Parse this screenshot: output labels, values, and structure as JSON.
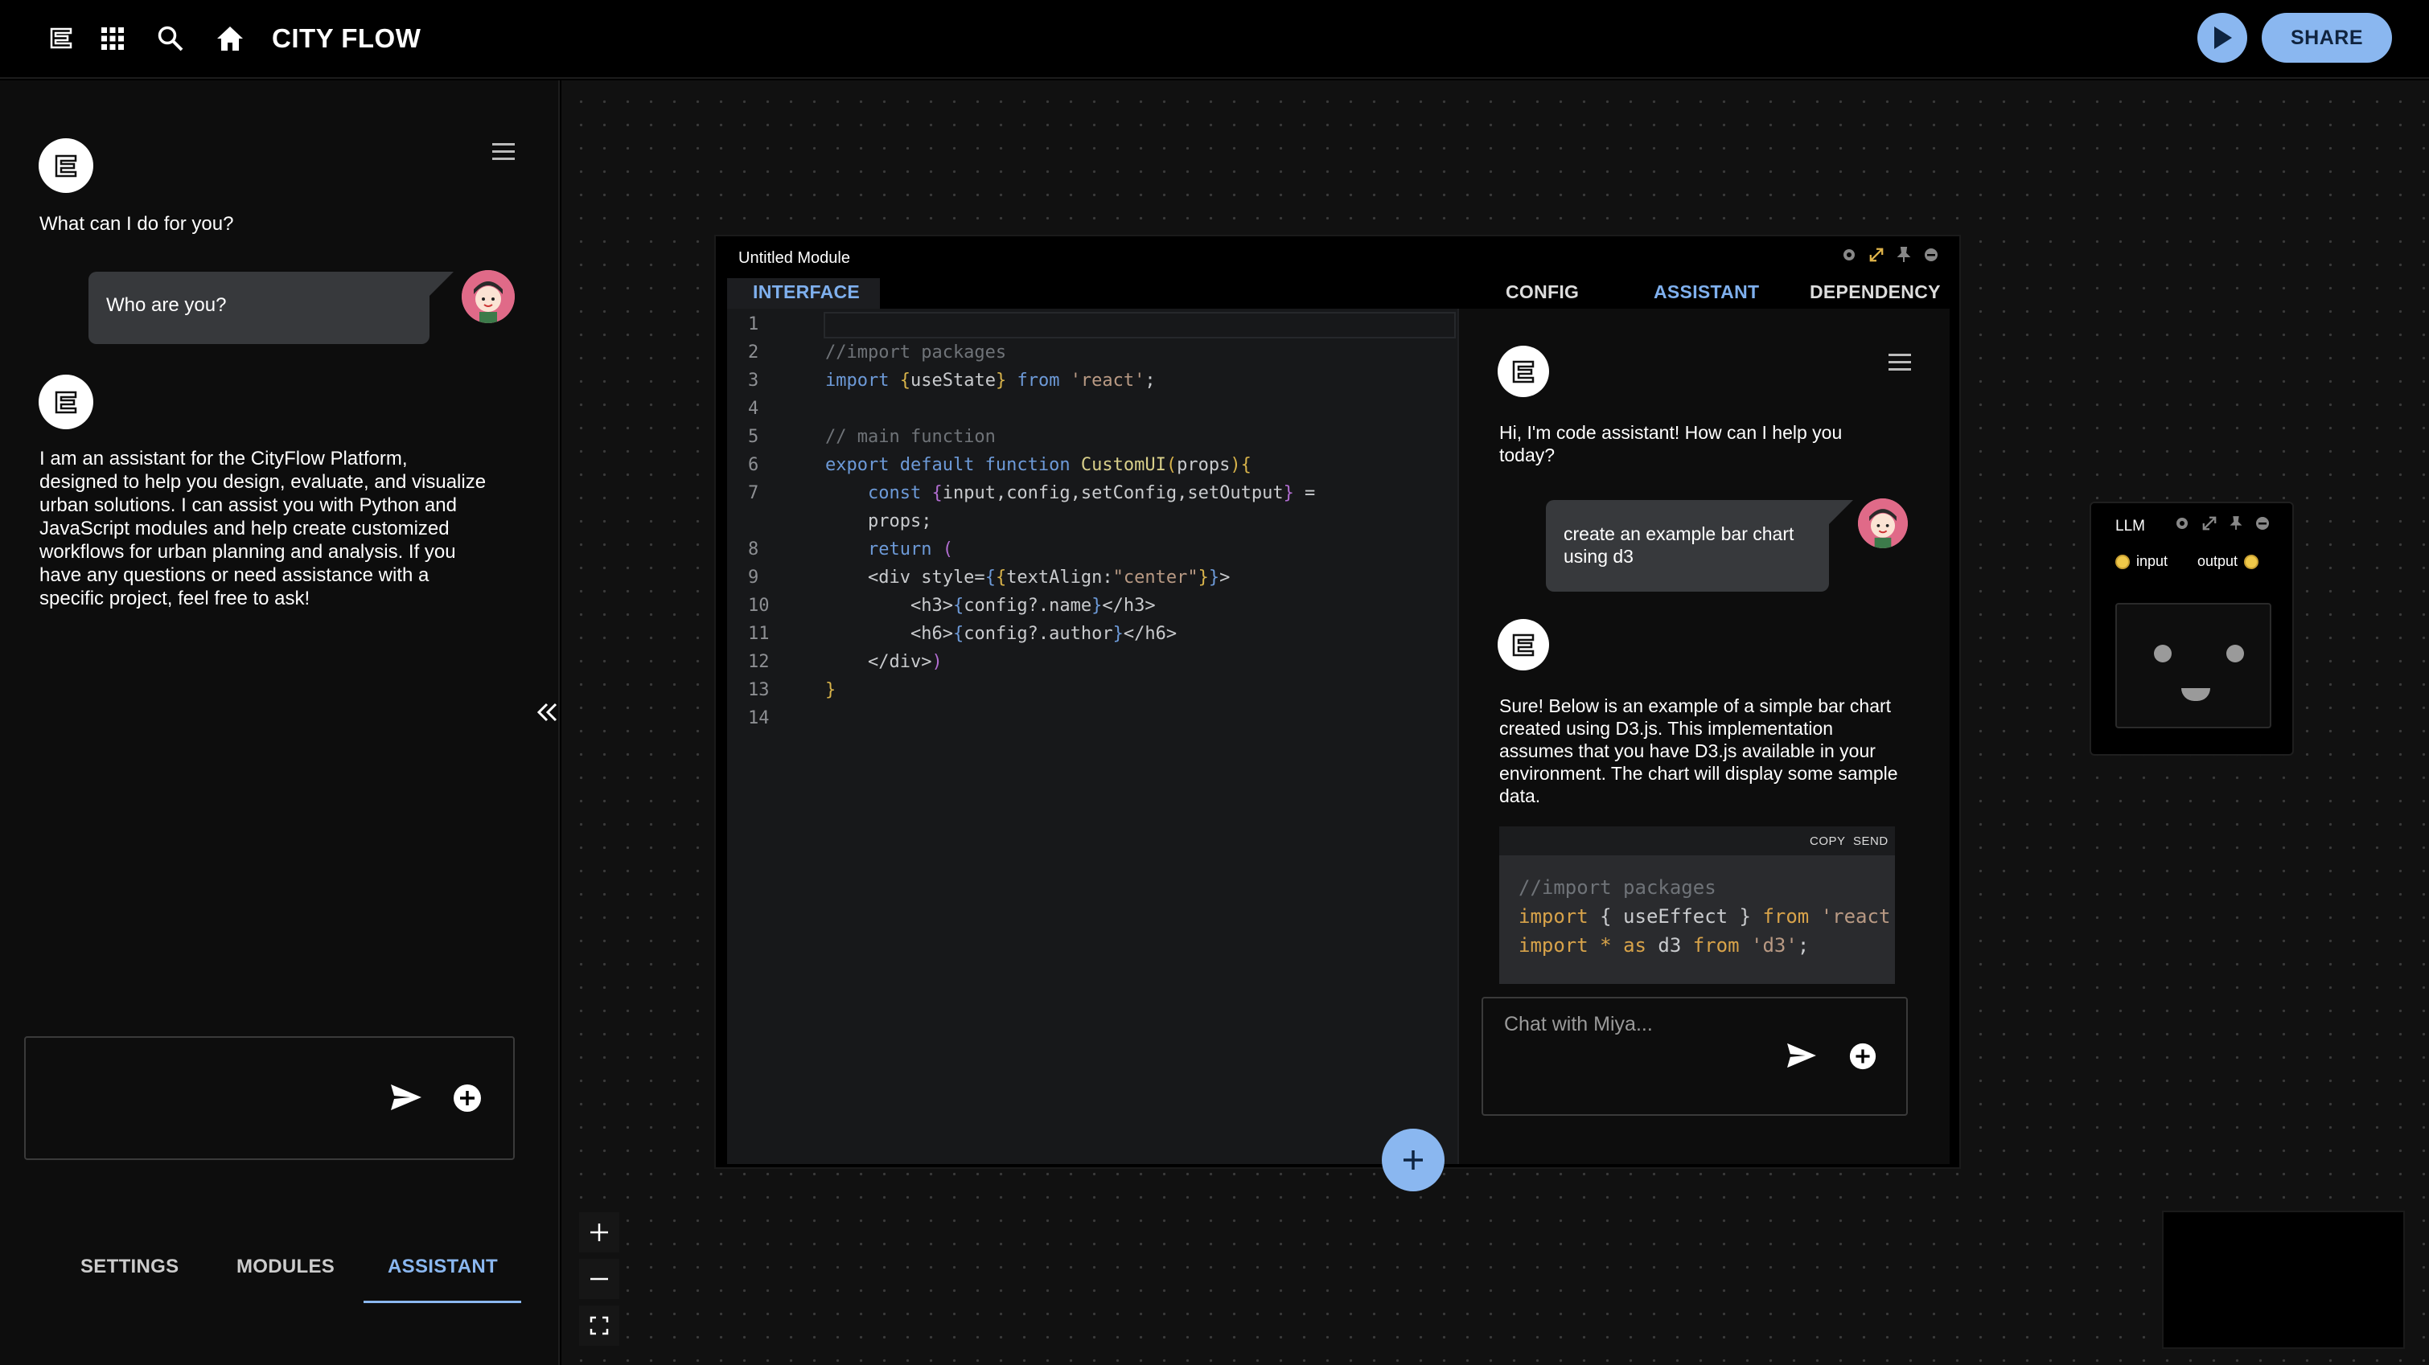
{
  "app": {
    "title": "CITY FLOW",
    "share_label": "SHARE"
  },
  "left_panel": {
    "greeting": "What can I do for you?",
    "user_message": "Who are you?",
    "assistant_reply": "I am an assistant for the CityFlow Platform, designed to help you design, evaluate, and visualize urban solutions. I can assist you with Python and JavaScript modules and help create customized workflows for urban planning and analysis. If you have any questions or need assistance with a specific project, feel free to ask!",
    "input_value": "",
    "tabs": [
      {
        "label": "SETTINGS"
      },
      {
        "label": "MODULES"
      },
      {
        "label": "ASSISTANT"
      }
    ]
  },
  "module": {
    "title": "Untitled Module",
    "tabs": [
      {
        "label": "INTERFACE"
      },
      {
        "label": "CONFIG"
      },
      {
        "label": "ASSISTANT"
      },
      {
        "label": "DEPENDENCY"
      }
    ],
    "line_numbers": [
      "1",
      "2",
      "3",
      "4",
      "5",
      "6",
      "7",
      "",
      "8",
      "9",
      "10",
      "11",
      "12",
      "13",
      "14"
    ],
    "assistant": {
      "greeting": "Hi, I'm code assistant! How can I help you today?",
      "user_message": "create an example bar chart using d3",
      "reply": "Sure! Below is an example of a simple bar chart created using D3.js. This implementation assumes that you have D3.js available in your environment. The chart will display some sample data.",
      "code_actions": [
        "COPY",
        "SEND"
      ],
      "input_placeholder": "Chat with Miya..."
    }
  },
  "llm_node": {
    "title": "LLM",
    "input_label": "input",
    "output_label": "output"
  },
  "colors": {
    "accent": "#8ab7f0",
    "port": "#f0c94a"
  }
}
